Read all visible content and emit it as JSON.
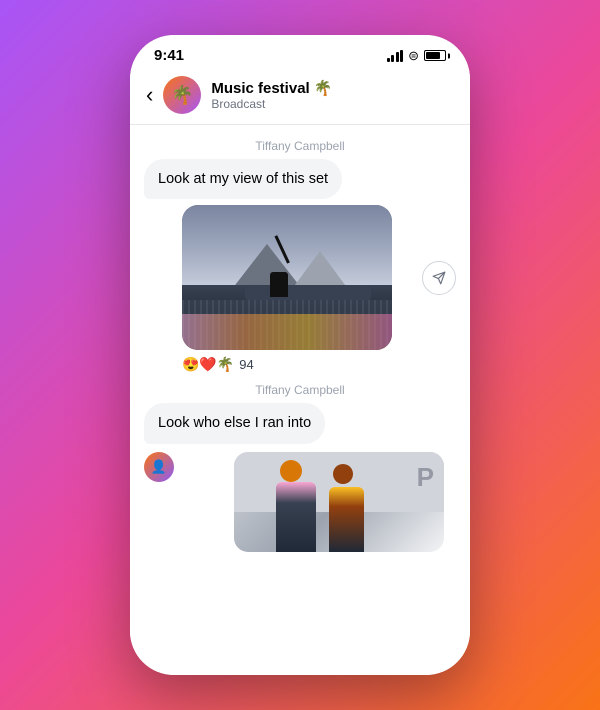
{
  "phone": {
    "status_bar": {
      "time": "9:41",
      "signal_icon": "signal-icon",
      "wifi_icon": "wifi-icon",
      "battery_icon": "battery-icon"
    },
    "header": {
      "back_label": "‹",
      "avatar_emoji": "🌴",
      "title": "Music festival 🌴",
      "subtitle": "Broadcast"
    },
    "messages": [
      {
        "sender": "Tiffany Campbell",
        "type": "text",
        "text": "Look at my view of this set",
        "direction": "incoming"
      },
      {
        "type": "image",
        "alt": "DJ at festival set"
      },
      {
        "type": "reactions",
        "emojis": "😍❤️🌴",
        "count": "94"
      },
      {
        "sender": "Tiffany Campbell",
        "type": "text",
        "text": "Look who else I ran into",
        "direction": "incoming"
      },
      {
        "type": "image",
        "alt": "People at festival"
      }
    ],
    "share_icon": "▷"
  }
}
